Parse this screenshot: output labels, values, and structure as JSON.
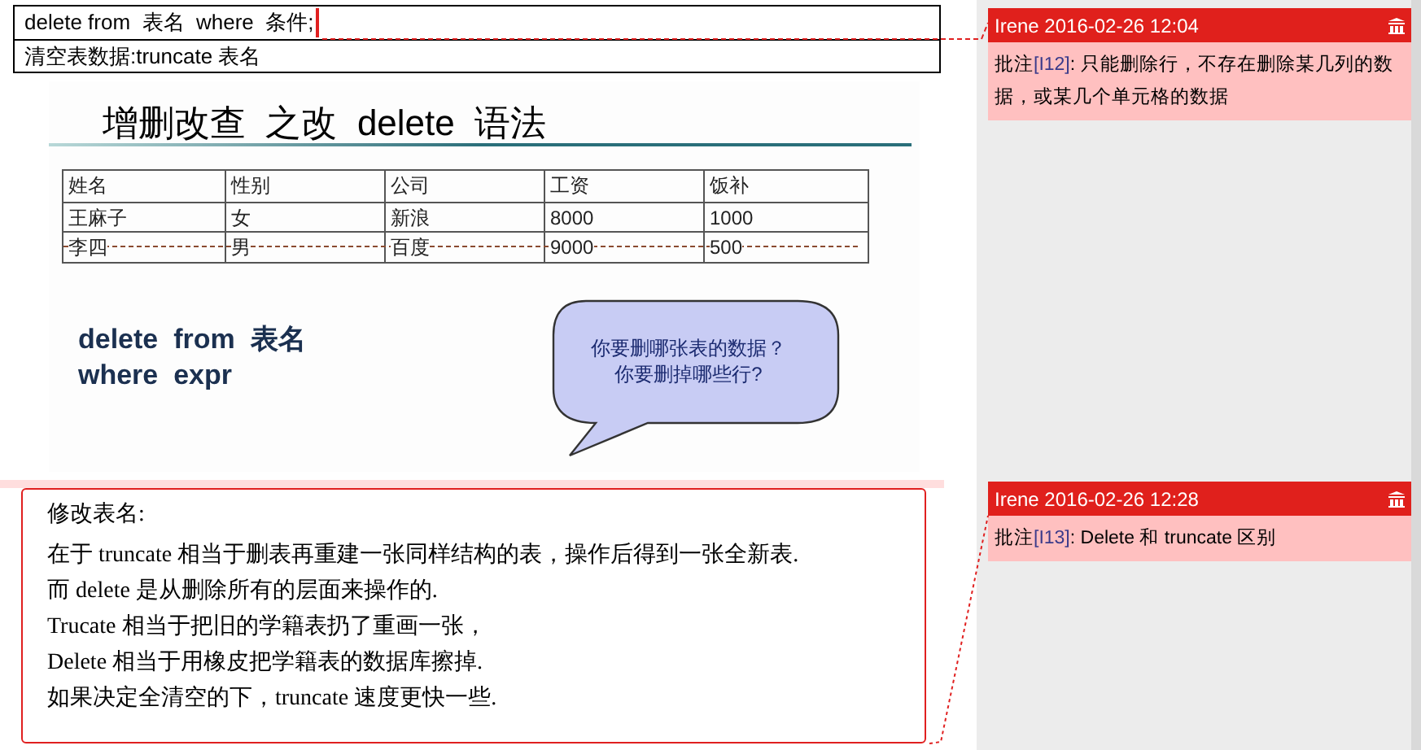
{
  "document": {
    "sql_table": {
      "rows": [
        "delete from  表名  where  条件;",
        "清空表数据:truncate 表名"
      ]
    },
    "slide": {
      "title": "增删改查  之改  delete  语法",
      "table": {
        "columns": [
          "姓名",
          "性别",
          "公司",
          "工资",
          "饭补"
        ],
        "rows": [
          {
            "cells": [
              "王麻子",
              "女",
              "新浪",
              "8000",
              "1000"
            ],
            "struck": false
          },
          {
            "cells": [
              "李四",
              "男",
              "百度",
              "9000",
              "500"
            ],
            "struck": true
          }
        ]
      },
      "code_lines": [
        "delete  from  表名",
        "where  expr"
      ],
      "callout_lines": [
        "你要删哪张表的数据？",
        "你要删掉哪些行?"
      ]
    },
    "note_box": {
      "heading": "修改表名:",
      "lines": [
        "在于 truncate 相当于删表再重建一张同样结构的表，操作后得到一张全新表.",
        "而 delete 是从删除所有的层面来操作的.",
        "Trucate 相当于把旧的学籍表扔了重画一张，",
        "Delete 相当于用橡皮把学籍表的数据库擦掉.",
        "如果决定全清空的下，truncate 速度更快一些."
      ]
    }
  },
  "comments": [
    {
      "header": "Irene 2016-02-26 12:04",
      "label": "批注",
      "ref": "[I12]",
      "text": ": 只能删除行，不存在删除某几列的数据，或某几个单元格的数据"
    },
    {
      "header": "Irene 2016-02-26 12:28",
      "label": "批注",
      "ref": "[I13]",
      "text": ": Delete 和 truncate 区别"
    }
  ]
}
